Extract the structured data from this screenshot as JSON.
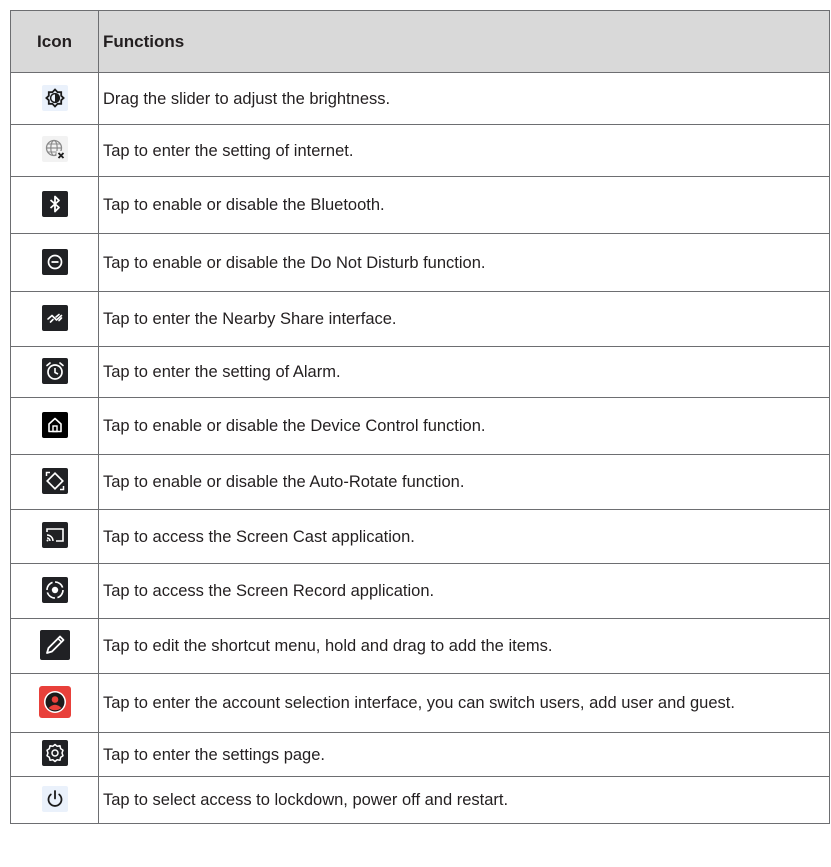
{
  "table": {
    "headers": {
      "icon": "Icon",
      "functions": "Functions"
    },
    "rows": [
      {
        "icon": "brightness-icon",
        "text": "Drag the slider to adjust the brightness."
      },
      {
        "icon": "internet-off-icon",
        "text": "Tap to enter the setting of internet."
      },
      {
        "icon": "bluetooth-icon",
        "text": "Tap to enable or disable the Bluetooth."
      },
      {
        "icon": "do-not-disturb-icon",
        "text": "Tap to enable or disable the Do Not Disturb function."
      },
      {
        "icon": "nearby-share-icon",
        "text": "Tap to enter the Nearby Share interface."
      },
      {
        "icon": "alarm-icon",
        "text": "Tap to enter the setting of Alarm."
      },
      {
        "icon": "device-control-icon",
        "text": "Tap to enable or disable the Device Control function."
      },
      {
        "icon": "auto-rotate-icon",
        "text": "Tap to enable or disable the Auto-Rotate function."
      },
      {
        "icon": "screen-cast-icon",
        "text": "Tap to access the Screen Cast application."
      },
      {
        "icon": "screen-record-icon",
        "text": "Tap to access the Screen Record application."
      },
      {
        "icon": "edit-pencil-icon",
        "text": "Tap to edit the shortcut menu, hold and drag to add the items."
      },
      {
        "icon": "account-icon",
        "text": "Tap to enter the account selection interface, you can switch users, add user and guest."
      },
      {
        "icon": "settings-icon",
        "text": "Tap to enter the settings page."
      },
      {
        "icon": "power-icon",
        "text": "Tap to select access to lockdown, power off and restart."
      }
    ]
  },
  "colors": {
    "header_bg": "#d9d9d9",
    "border": "#6d6e71",
    "icon_dark_bg": "#202124",
    "account_red": "#e8403a"
  }
}
